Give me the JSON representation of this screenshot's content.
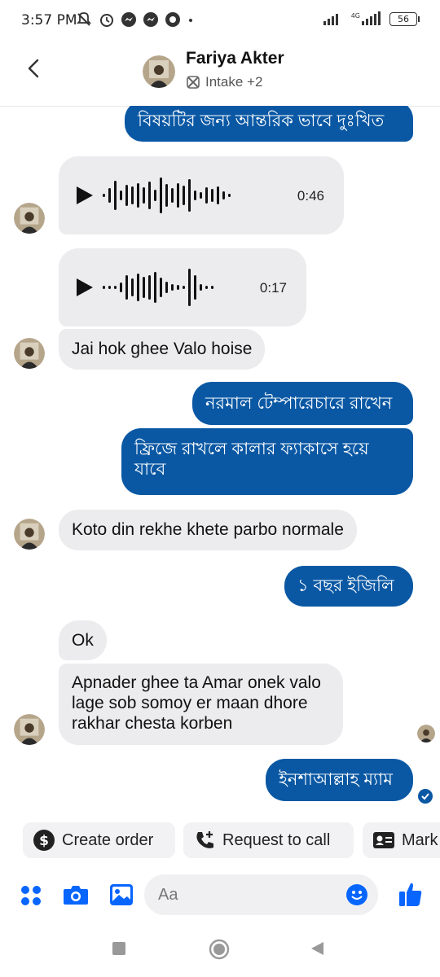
{
  "status": {
    "time": "3:57 PM",
    "network": "4G",
    "battery": "56",
    "icons": [
      "mute-icon",
      "alarm-icon",
      "messenger-icon",
      "messenger-icon",
      "chrome-icon",
      "dot-icon"
    ]
  },
  "header": {
    "name": "Fariya Akter",
    "subtitle": "Intake +2"
  },
  "messages": [
    {
      "dir": "out",
      "text": "বিষয়টির জন্য আন্তরিক ভাবে দুঃখিত"
    },
    {
      "dir": "in",
      "type": "audio",
      "duration": "0:46"
    },
    {
      "dir": "in",
      "type": "audio",
      "duration": "0:17"
    },
    {
      "dir": "in",
      "text": "Jai hok ghee Valo hoise"
    },
    {
      "dir": "out",
      "text": "নরমাল টেম্পারেচারে রাখেন"
    },
    {
      "dir": "out",
      "text": "ফ্রিজে রাখলে কালার ফ্যাকাসে হয়ে যাবে"
    },
    {
      "dir": "in",
      "text": "Koto din rekhe khete parbo normale"
    },
    {
      "dir": "out",
      "text": "১ বছর ইজিলি"
    },
    {
      "dir": "in",
      "text": "Ok"
    },
    {
      "dir": "in",
      "text": "Apnader ghee ta Amar onek valo lage sob somoy er maan dhore rakhar chesta korben"
    },
    {
      "dir": "out",
      "text": "ইনশাআল্লাহ ম্যাম"
    }
  ],
  "actions": {
    "create_order": "Create order",
    "request_call": "Request to call",
    "mark": "Mark"
  },
  "composer": {
    "placeholder": "Aa"
  },
  "colors": {
    "outgoing_bubble": "#0a58a4",
    "incoming_bubble": "#ececee",
    "accent": "#0866ff"
  }
}
